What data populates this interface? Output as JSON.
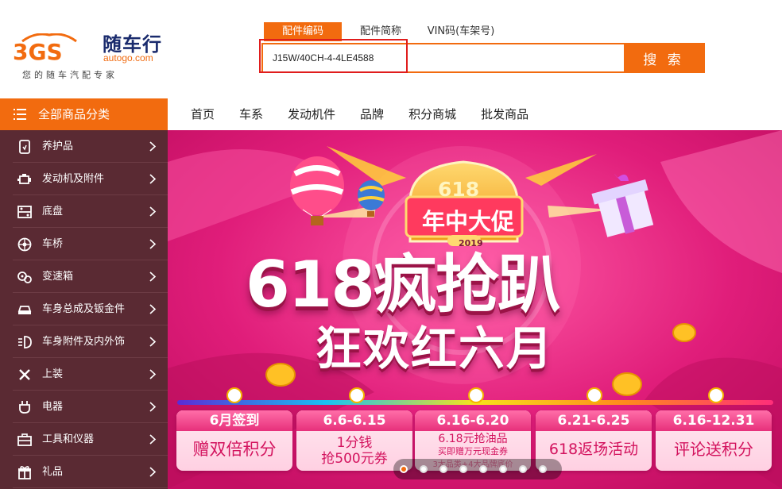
{
  "logo": {
    "brand_cn": "随车行",
    "brand_en": "autogo.com",
    "slogan": "您的随车汽配专家",
    "mark": "3GS"
  },
  "search": {
    "tabs": [
      "配件编码",
      "配件简称",
      "VIN码(车架号)"
    ],
    "active_tab": "配件编码",
    "value": "J15W/40CH-4-4LE4588",
    "button_label": "搜 索"
  },
  "nav": {
    "all_categories": "全部商品分类",
    "links": [
      "首页",
      "车系",
      "发动机件",
      "品牌",
      "积分商城",
      "批发商品"
    ]
  },
  "sidebar": {
    "items": [
      {
        "label": "养护品",
        "icon": "maintenance-icon"
      },
      {
        "label": "发动机及附件",
        "icon": "engine-icon"
      },
      {
        "label": "底盘",
        "icon": "chassis-icon"
      },
      {
        "label": "车桥",
        "icon": "axle-icon"
      },
      {
        "label": "变速箱",
        "icon": "gearbox-icon"
      },
      {
        "label": "车身总成及钣金件",
        "icon": "car-body-icon"
      },
      {
        "label": "车身附件及内外饰",
        "icon": "headlight-icon"
      },
      {
        "label": "上装",
        "icon": "tools-cross-icon"
      },
      {
        "label": "电器",
        "icon": "plug-icon"
      },
      {
        "label": "工具和仪器",
        "icon": "toolbox-icon"
      },
      {
        "label": "礼品",
        "icon": "gift-icon"
      }
    ]
  },
  "banner": {
    "badge_number": "618",
    "badge_title": "年中大促",
    "badge_year": "2019",
    "headline": "618疯抢趴",
    "subheadline": "狂欢红六月",
    "promos": [
      {
        "head": "6月签到",
        "body": "赠双倍积分"
      },
      {
        "head": "6.6-6.15",
        "body": "1分钱",
        "body2": "抢500元券"
      },
      {
        "head": "6.16-6.20",
        "body": "6.18元抢油品",
        "sub": "买即赠万元现金券",
        "foot": "3大品类+4大品牌底价"
      },
      {
        "head": "6.21-6.25",
        "body": "618返场活动"
      },
      {
        "head": "6.16-12.31",
        "body": "评论送积分"
      }
    ],
    "slide_count": 8,
    "active_slide": 0
  },
  "colors": {
    "accent": "#f26b0f",
    "sidebar_bg": "#5a2a33",
    "banner_bg": "#d4156e",
    "highlight": "#e01d1d"
  }
}
